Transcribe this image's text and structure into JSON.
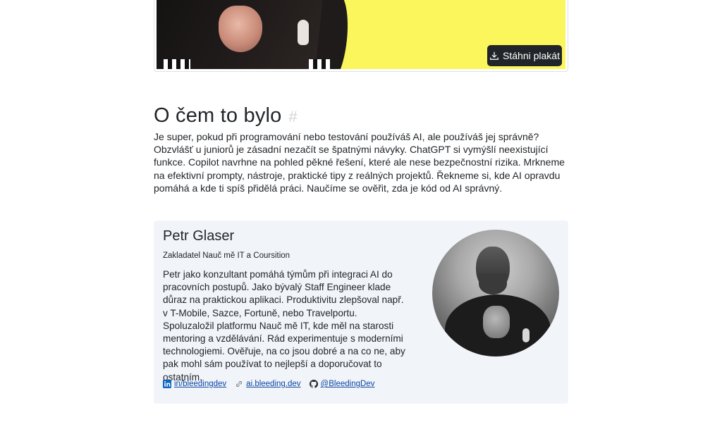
{
  "poster": {
    "download_label": "Stáhni plakát",
    "download_icon": "download-icon",
    "accent_yellow": "#fbf65b"
  },
  "section": {
    "title": "O čem to bylo",
    "anchor": "#",
    "intro": "Je super, pokud při programování nebo testování používáš AI, ale používáš jej správně? Obzvlášť u juniorů je zásadní nezačít se špatnými návyky. ChatGPT si vymýšlí neexistující funkce. Copilot navrhne na pohled pěkné řešení, které ale nese bezpečnostní rizika. Mrkneme na efektivní prompty, nástroje, praktické tipy z reálných projektů. Řekneme si, kde AI opravdu pomáhá a kde ti spíš přidělá práci. Naučíme se ověřit, zda je kód od AI správný."
  },
  "speaker": {
    "name": "Petr Glaser",
    "role": "Zakladatel Nauč mě IT a Coursition",
    "bio": "Petr jako konzultant pomáhá týmům při integraci AI do pracovních postupů. Jako bývalý Staff Engineer klade důraz na praktickou aplikaci. Produktivitu zlepšoval např. v T-Mobile, Sazce, Fortuně, nebo Travelportu. Spoluzaložil platformu Nauč mě IT, kde měl na starosti mentoring a vzdělávání. Rád experimentuje s moderními technologiemi. Ověřuje, na co jsou dobré a na co ne, aby pak mohl sám používat to nejlepší a doporučovat to ostatním.",
    "links": [
      {
        "label": "in/bleedingdev",
        "icon": "linkedin-icon"
      },
      {
        "label": "ai.bleeding.dev",
        "icon": "link-icon"
      },
      {
        "label": "@BleedingDev",
        "icon": "github-icon"
      }
    ],
    "card_background": "#f1f5fa",
    "link_color": "#0d47a1"
  }
}
